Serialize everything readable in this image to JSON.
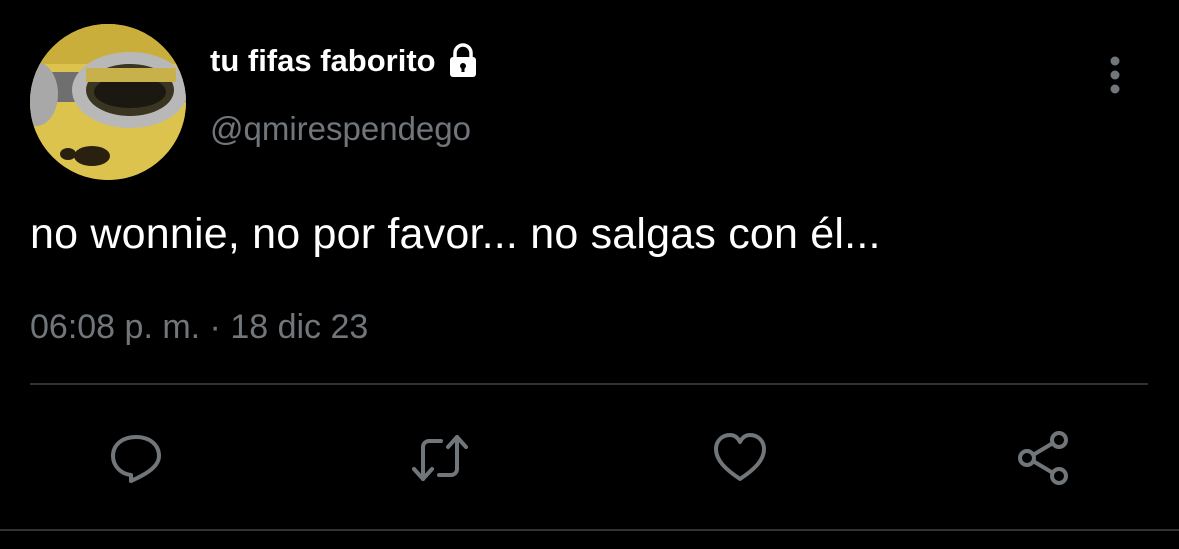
{
  "tweet": {
    "display_name": "tu fifas faborito",
    "handle": "@qmirespendego",
    "text": "no wonnie, no por favor... no salgas con él...",
    "timestamp": "06:08 p. m. · 18 dic 23",
    "protected_icon": "lock-icon",
    "more_icon": "more-vertical-icon"
  },
  "actions": [
    {
      "name": "reply",
      "icon": "reply-icon"
    },
    {
      "name": "retweet",
      "icon": "retweet-icon"
    },
    {
      "name": "like",
      "icon": "heart-icon"
    },
    {
      "name": "share",
      "icon": "share-icon"
    }
  ],
  "colors": {
    "background": "#000000",
    "text_primary": "#ffffff",
    "text_secondary": "#71767b",
    "divider": "#2f3336",
    "icon": "#71767b"
  }
}
